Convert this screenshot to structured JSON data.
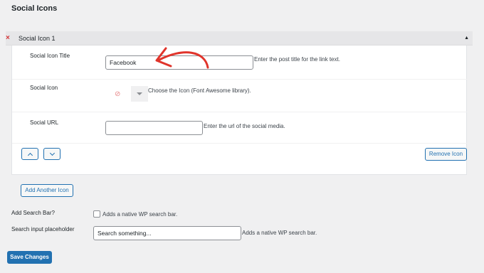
{
  "page": {
    "section_title": "Social Icons"
  },
  "panel": {
    "remove_mark": "×",
    "title": "Social Icon 1",
    "collapse_caret": "▲",
    "fields": {
      "title_label": "Social Icon Title",
      "title_value": "Facebook",
      "title_desc": "Enter the post title for the link text.",
      "icon_label": "Social Icon",
      "icon_none_glyph": "⊘",
      "icon_desc": "Choose the Icon (Font Awesome library).",
      "url_label": "Social URL",
      "url_value": "",
      "url_desc": "Enter the url of the social media."
    },
    "move_up_icon": "chevron-up-icon",
    "move_down_icon": "chevron-down-icon",
    "remove_label": "Remove Icon"
  },
  "add_another_label": "Add Another Icon",
  "search": {
    "bar_label": "Add Search Bar?",
    "bar_checked": false,
    "bar_desc": "Adds a native WP search bar.",
    "placeholder_label": "Search input placeholder",
    "placeholder_value": "Search something...",
    "placeholder_desc": "Adds a native WP search bar."
  },
  "save_label": "Save Changes",
  "annotation": {
    "arrow_color": "#e0342b"
  }
}
